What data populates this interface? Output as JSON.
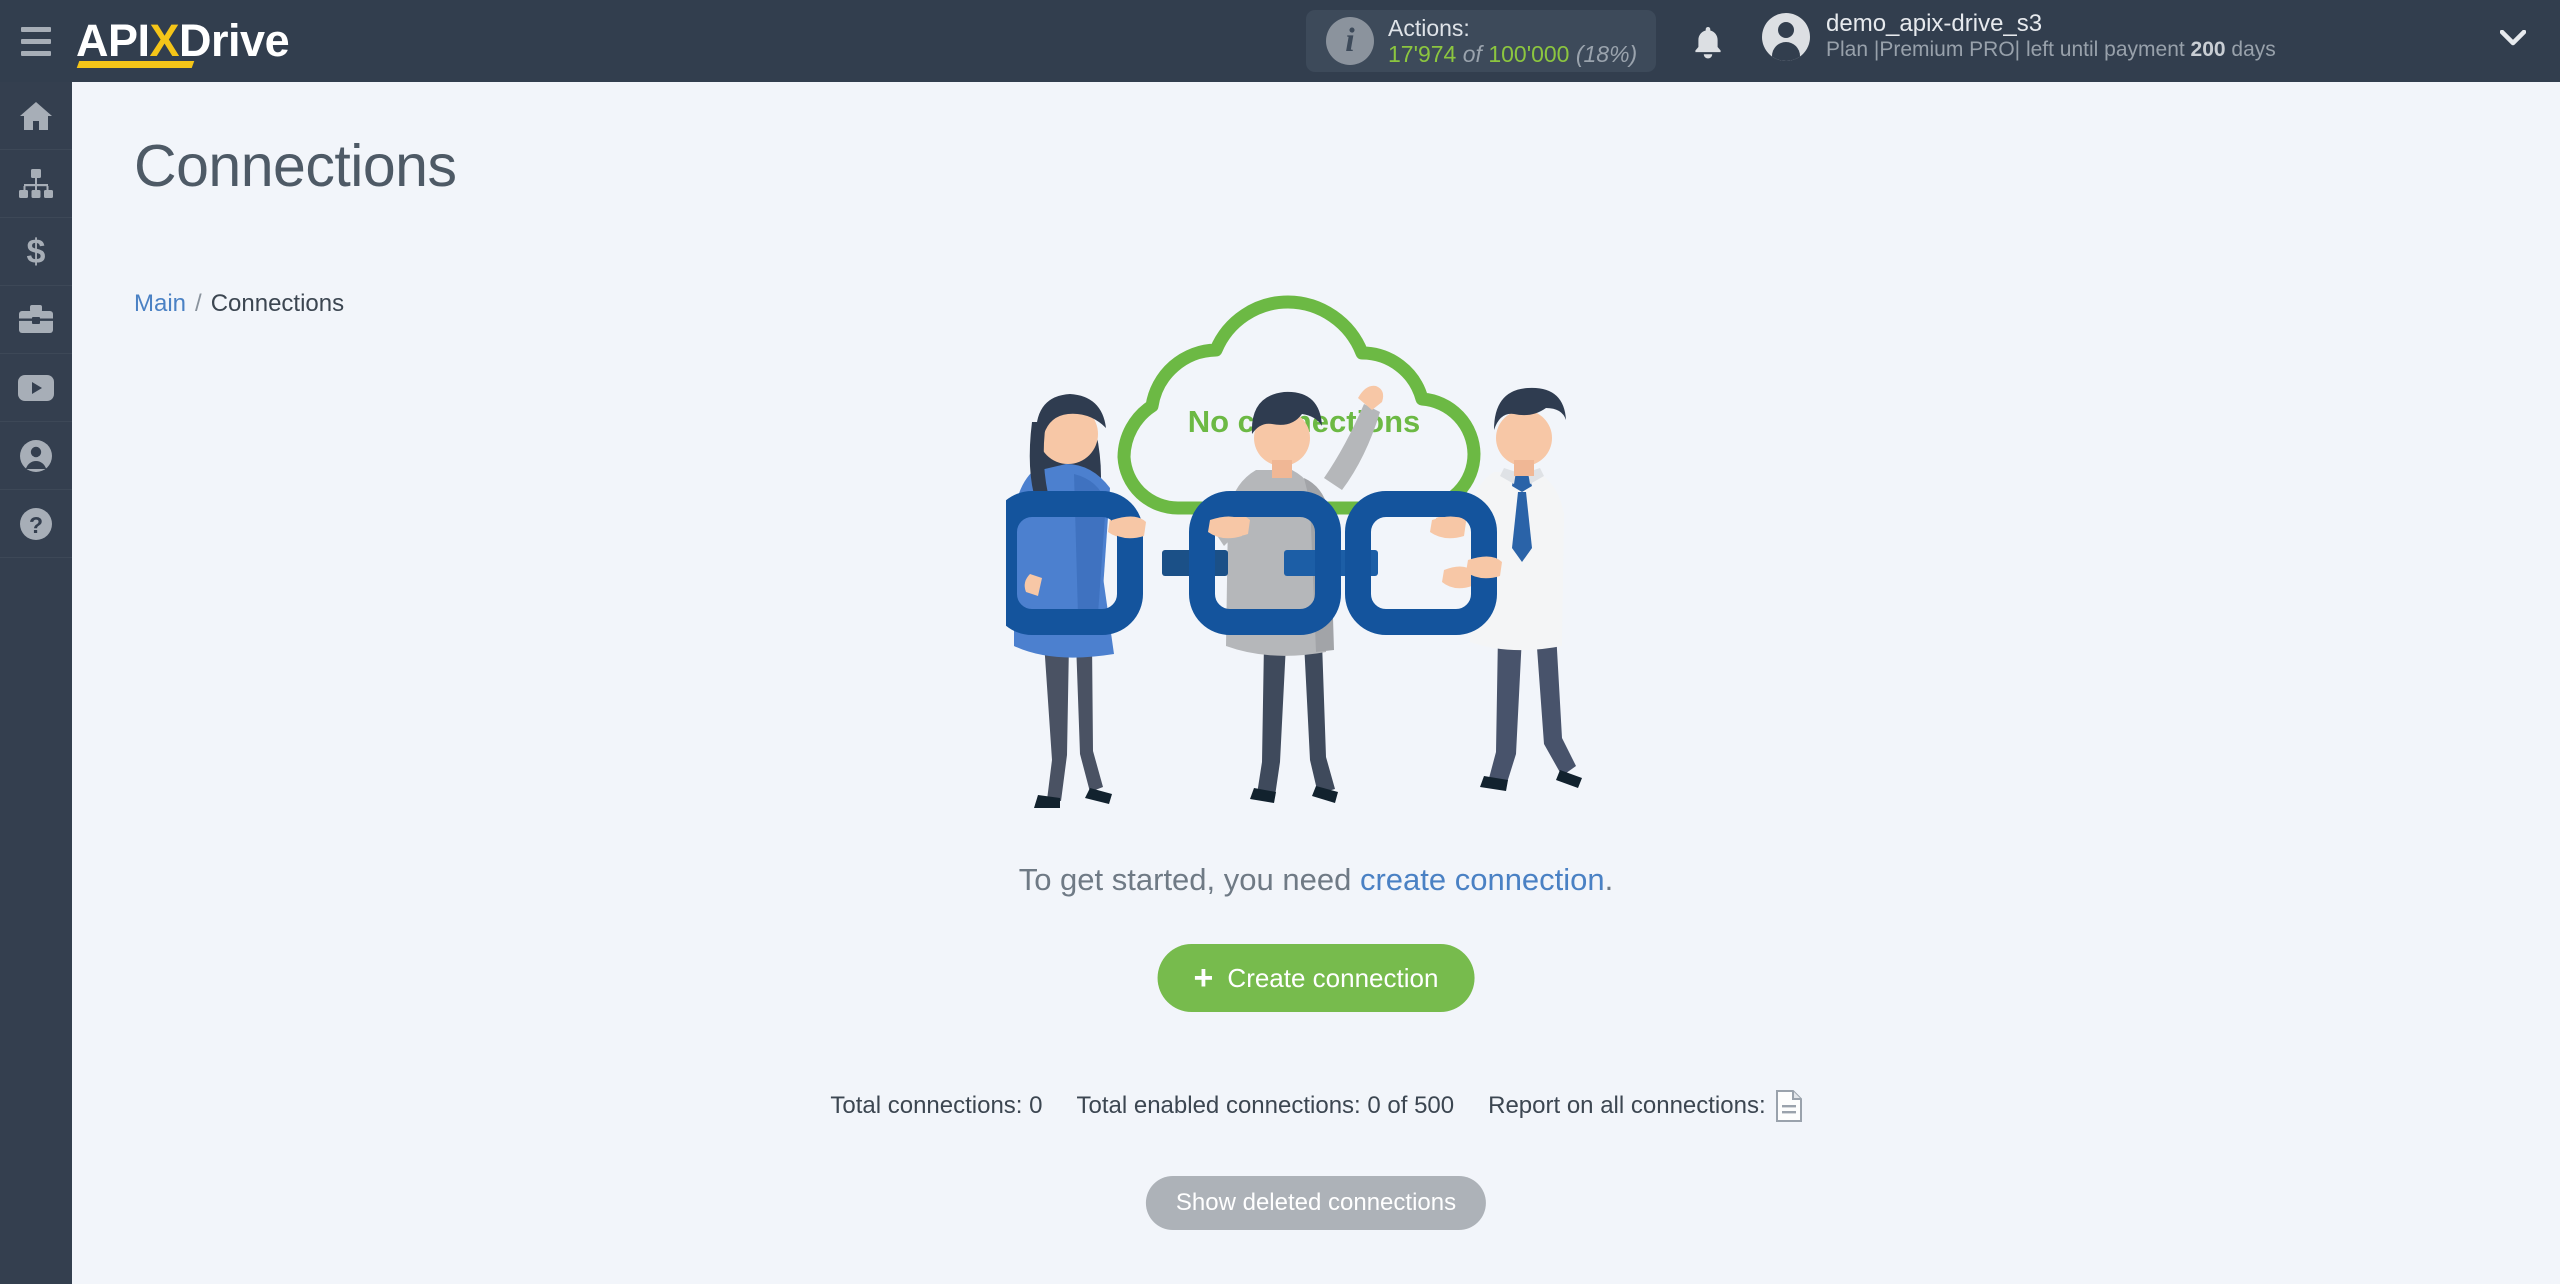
{
  "topbar": {
    "menu_icon": "hamburger-icon",
    "logo": {
      "part1": "API",
      "part2": "X",
      "part3": "Drive"
    },
    "actions": {
      "info_icon": "info-icon",
      "label": "Actions:",
      "used": "17'974",
      "of": "of",
      "total": "100'000",
      "percent": "(18%)"
    },
    "bell_icon": "bell-icon",
    "user": {
      "avatar_icon": "user-avatar-icon",
      "name": "demo_apix-drive_s3",
      "plan_prefix": "Plan |Premium PRO| left until payment ",
      "plan_days": "200",
      "plan_suffix": " days"
    },
    "chevron_icon": "chevron-down-icon"
  },
  "sidebar": {
    "items": [
      {
        "name": "home",
        "icon": "home-icon"
      },
      {
        "name": "connections",
        "icon": "sitemap-icon"
      },
      {
        "name": "billing",
        "icon": "dollar-icon"
      },
      {
        "name": "business",
        "icon": "briefcase-icon"
      },
      {
        "name": "video",
        "icon": "youtube-icon"
      },
      {
        "name": "profile",
        "icon": "person-icon"
      },
      {
        "name": "help",
        "icon": "question-circle-icon"
      }
    ]
  },
  "main": {
    "page_title": "Connections",
    "breadcrumb": {
      "home": "Main",
      "separator": "/",
      "current": "Connections"
    },
    "illustration": {
      "cloud_text": "No connections",
      "cloud_color": "#6cb944",
      "chain_color": "#1a5ba6"
    },
    "cta": {
      "prefix": "To get started, you need ",
      "link": "create connection",
      "suffix": "."
    },
    "create_button": {
      "plus": "+",
      "label": "Create connection",
      "color": "#77bb4d"
    },
    "stats": {
      "total_connections": "Total connections: 0",
      "total_enabled": "Total enabled connections: 0 of 500",
      "report_label": "Report on all connections:",
      "report_icon": "document-icon"
    },
    "show_deleted_button": {
      "label": "Show deleted connections",
      "color": "#adb2b8"
    }
  }
}
